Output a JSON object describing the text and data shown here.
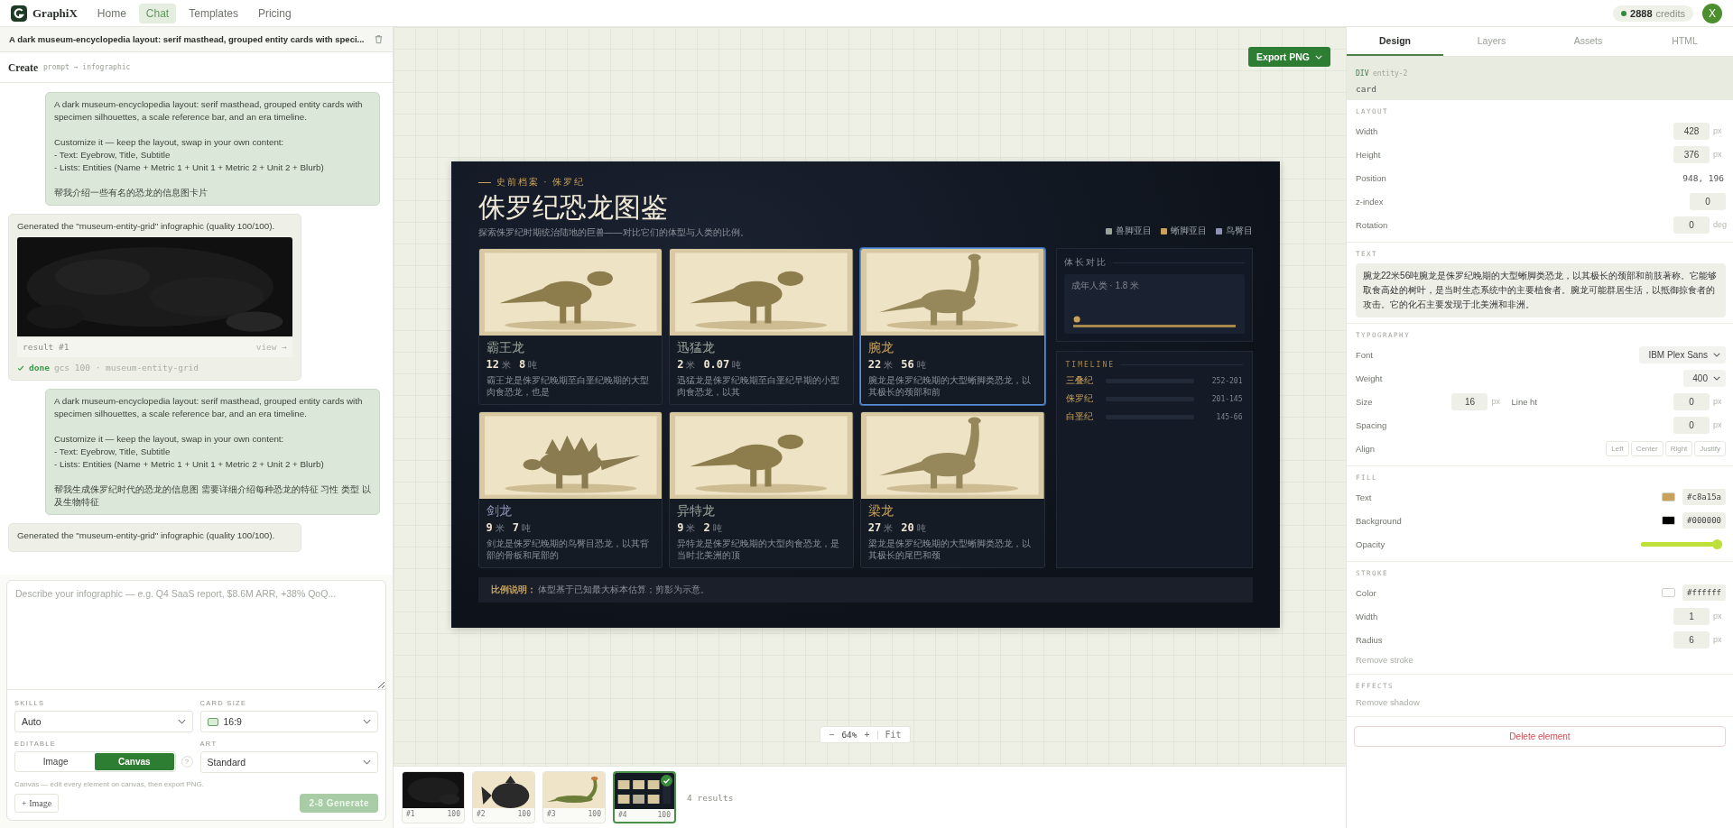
{
  "nav": {
    "brand": "GraphiX",
    "links": [
      {
        "label": "Home",
        "selected": false
      },
      {
        "label": "Chat",
        "selected": true
      },
      {
        "label": "Templates",
        "selected": false
      },
      {
        "label": "Pricing",
        "selected": false
      }
    ],
    "credits": "2888",
    "credits_label": "credits",
    "avatar": "X"
  },
  "chat": {
    "title": "A dark museum-encyclopedia layout: serif masthead, grouped entity cards with speci...",
    "create": "Create",
    "create_hint": "prompt → infographic",
    "messages": [
      {
        "kind": "user",
        "paragraphs": [
          [
            "A dark museum-encyclopedia layout: serif masthead, grouped entity cards with specimen silhouettes, a scale reference bar, and an era timeline."
          ],
          [
            "Customize it — keep the layout, swap in your own content:",
            "- Text: Eyebrow, Title, Subtitle",
            "- Lists: Entities (Name + Metric 1 + Unit 1 + Metric 2 + Unit 2 + Blurb)"
          ],
          [
            "帮我介绍一些有名的恐龙的信息图卡片"
          ]
        ]
      },
      {
        "kind": "result",
        "text": "Generated the \"museum-entity-grid\" infographic (quality 100/100).",
        "result_label": "result #1",
        "view": "view →",
        "status": "done",
        "meta": "gcs 100 · museum-entity-grid"
      },
      {
        "kind": "user",
        "paragraphs": [
          [
            "A dark museum-encyclopedia layout: serif masthead, grouped entity cards with specimen silhouettes, a scale reference bar, and an era timeline."
          ],
          [
            "Customize it — keep the layout, swap in your own content:",
            "- Text: Eyebrow, Title, Subtitle",
            "- Lists: Entities (Name + Metric 1 + Unit 1 + Metric 2 + Unit 2 + Blurb)"
          ],
          [
            "帮我生成侏罗纪时代的恐龙的信息图 需要详细介绍每种恐龙的特征 习性 类型 以及生物特征"
          ]
        ]
      },
      {
        "kind": "note",
        "text": "Generated the \"museum-entity-grid\" infographic (quality 100/100)."
      }
    ]
  },
  "composer": {
    "placeholder": "Describe your infographic — e.g. Q4 SaaS report, $8.6M ARR, +38% QoQ...",
    "skills_label": "SKILLS",
    "skills": "Auto",
    "size_label": "CARD SIZE",
    "size": "16:9",
    "editable_label": "EDITABLE",
    "editable_options": [
      {
        "label": "Image",
        "selected": false
      },
      {
        "label": "Canvas",
        "selected": true
      }
    ],
    "help": "?",
    "art_label": "ART",
    "art": "Standard",
    "hint": "Canvas — edit every element on canvas, then export PNG.",
    "image_button": "+ Image",
    "generate": {
      "label": "2-8 Generate",
      "disabled": true
    }
  },
  "canvas": {
    "export": "Export PNG",
    "zoom_out": "−",
    "zoom": "64%",
    "zoom_in": "+",
    "fit": "Fit",
    "thumbnails": [
      {
        "label": "#1",
        "score": "100",
        "selected": false
      },
      {
        "label": "#2",
        "score": "100",
        "selected": false
      },
      {
        "label": "#3",
        "score": "100",
        "selected": false
      },
      {
        "label": "#4",
        "score": "100",
        "selected": true
      }
    ],
    "results": "4 results"
  },
  "infographic": {
    "eyebrow": "史前档案 · 侏罗纪",
    "title": "侏罗纪恐龙图鉴",
    "subtitle": "探索侏罗纪时期统治陆地的巨兽——对比它们的体型与人类的比例。",
    "legend": [
      {
        "label": "兽脚亚目",
        "color": "#9aa59a"
      },
      {
        "label": "蜥脚亚目",
        "color": "#c8a15a"
      },
      {
        "label": "鸟臀目",
        "color": "#8e92b4"
      }
    ],
    "cards": [
      {
        "name": "霸王龙",
        "metric1": "12",
        "unit1": "米",
        "metric2": "8",
        "unit2": "吨",
        "blurb": "霸王龙是侏罗纪晚期至白垩纪晚期的大型肉食恐龙，也是",
        "color": "#9aa59a",
        "selected": false
      },
      {
        "name": "迅猛龙",
        "metric1": "2",
        "unit1": "米",
        "metric2": "0.07",
        "unit2": "吨",
        "blurb": "迅猛龙是侏罗纪晚期至白垩纪早期的小型肉食恐龙，以其",
        "color": "#9aa59a",
        "selected": false
      },
      {
        "name": "腕龙",
        "metric1": "22",
        "unit1": "米",
        "metric2": "56",
        "unit2": "吨",
        "blurb": "腕龙是侏罗纪晚期的大型蜥脚类恐龙，以其极长的颈部和前",
        "color": "#c8a15a",
        "selected": true
      },
      {
        "name": "剑龙",
        "metric1": "9",
        "unit1": "米",
        "metric2": "7",
        "unit2": "吨",
        "blurb": "剑龙是侏罗纪晚期的鸟臀目恐龙，以其背部的骨板和尾部的",
        "color": "#8e92b4",
        "selected": false
      },
      {
        "name": "异特龙",
        "metric1": "9",
        "unit1": "米",
        "metric2": "2",
        "unit2": "吨",
        "blurb": "异特龙是侏罗纪晚期的大型肉食恐龙，是当时北美洲的顶",
        "color": "#9aa59a",
        "selected": false
      },
      {
        "name": "梁龙",
        "metric1": "27",
        "unit1": "米",
        "metric2": "20",
        "unit2": "吨",
        "blurb": "梁龙是侏罗纪晚期的大型蜥脚类恐龙，以其极长的尾巴和颈",
        "color": "#c8a15a",
        "selected": false
      }
    ],
    "scale": {
      "title": "体长对比",
      "reference": "成年人类 · 1.8 米"
    },
    "timeline": {
      "title": "TIMELINE",
      "eras": [
        {
          "name": "三叠纪",
          "range": "252-201"
        },
        {
          "name": "侏罗纪",
          "range": "201-145"
        },
        {
          "name": "白垩纪",
          "range": "145-66"
        }
      ]
    },
    "footer_label": "比例说明：",
    "footer": "体型基于已知最大标本估算；剪影为示意。"
  },
  "inspector": {
    "tabs": [
      {
        "label": "Design",
        "selected": true
      },
      {
        "label": "Layers",
        "selected": false
      },
      {
        "label": "Assets",
        "selected": false
      },
      {
        "label": "HTML",
        "selected": false
      }
    ],
    "element": {
      "tag": "DIV",
      "id": "entity-2",
      "class_name": "card"
    },
    "sections": [
      {
        "title": "LAYOUT",
        "rows": [
          {
            "kind": "input",
            "label": "Width",
            "value": "428",
            "unit": "px"
          },
          {
            "kind": "input",
            "label": "Height",
            "value": "376",
            "unit": "px"
          },
          {
            "kind": "text",
            "label": "Position",
            "value": "948, 196"
          },
          {
            "kind": "input",
            "label": "z-index",
            "value": "0"
          },
          {
            "kind": "input",
            "label": "Rotation",
            "value": "0",
            "unit": "deg"
          }
        ]
      },
      {
        "title": "TEXT",
        "rows": [
          {
            "kind": "textarea",
            "value": "腕龙22米56吨腕龙是侏罗纪晚期的大型蜥脚类恐龙，以其极长的颈部和前肢著称。它能够取食高处的树叶，是当时生态系统中的主要植食者。腕龙可能群居生活，以抵御掠食者的攻击。它的化石主要发现于北美洲和非洲。"
          }
        ]
      },
      {
        "title": "TYPOGRAPHY",
        "rows": [
          {
            "kind": "select",
            "label": "Font",
            "value": "IBM Plex Sans"
          },
          {
            "kind": "select",
            "label": "Weight",
            "value": "400"
          },
          {
            "kind": "pair",
            "label": "Size",
            "value": "16",
            "unit": "px",
            "label2": "Line ht",
            "value2": "0",
            "unit2": "px"
          },
          {
            "kind": "input",
            "label": "Spacing",
            "value": "0",
            "unit": "px"
          },
          {
            "kind": "buttons",
            "label": "Align",
            "options": [
              {
                "label": "Left",
                "selected": false
              },
              {
                "label": "Center",
                "selected": false
              },
              {
                "label": "Right",
                "selected": false
              },
              {
                "label": "Justify",
                "selected": false
              }
            ]
          }
        ]
      },
      {
        "title": "FILL",
        "rows": [
          {
            "kind": "color",
            "label": "Text",
            "value": "#c8a15a"
          },
          {
            "kind": "color",
            "label": "Background",
            "value": "#000000"
          },
          {
            "kind": "slider",
            "label": "Opacity",
            "level": 1
          }
        ]
      },
      {
        "title": "STROKE",
        "rows": [
          {
            "kind": "color",
            "label": "Color",
            "value": "#ffffff"
          },
          {
            "kind": "input",
            "label": "Width",
            "value": "1",
            "unit": "px"
          },
          {
            "kind": "input",
            "label": "Radius",
            "value": "6",
            "unit": "px"
          },
          {
            "kind": "link",
            "label": "Remove stroke"
          }
        ]
      },
      {
        "title": "EFFECTS",
        "rows": [
          {
            "kind": "link",
            "label": "Remove shadow"
          }
        ]
      }
    ],
    "delete": "Delete element"
  }
}
